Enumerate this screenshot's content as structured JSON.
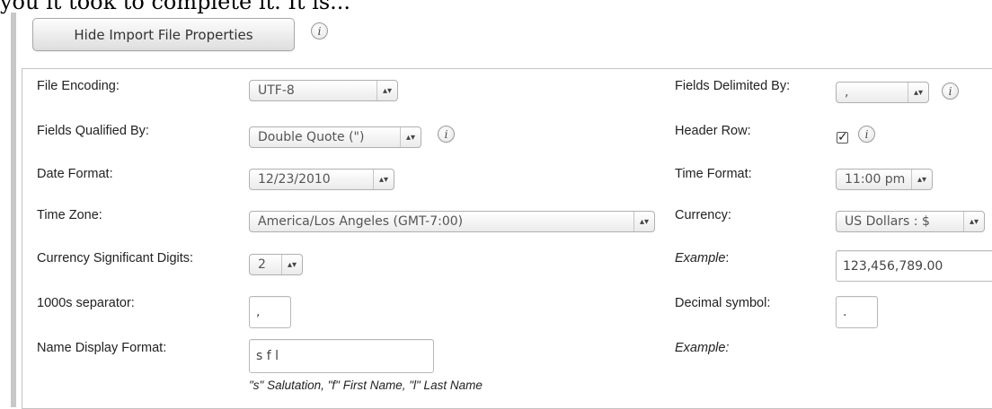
{
  "page": {
    "top_fragment": "you it took to complete it. It is..."
  },
  "toolbar": {
    "hide_button_label": "Hide Import File Properties"
  },
  "info_glyph": "i",
  "arrow_glyph": "▴▾",
  "check_glyph": "✓",
  "fields": {
    "file_encoding": {
      "label": "File Encoding:",
      "value": "UTF-8"
    },
    "fields_delimited_by": {
      "label": "Fields Delimited By:",
      "value": ","
    },
    "fields_qualified_by": {
      "label": "Fields Qualified By:",
      "value": "Double Quote (\")"
    },
    "header_row": {
      "label": "Header Row:",
      "checked": true
    },
    "date_format": {
      "label": "Date Format:",
      "value": "12/23/2010"
    },
    "time_format": {
      "label": "Time Format:",
      "value": "11:00 pm"
    },
    "time_zone": {
      "label": "Time Zone:",
      "value": "America/Los Angeles (GMT-7:00)"
    },
    "currency": {
      "label": "Currency:",
      "value": "US Dollars : $"
    },
    "currency_digits": {
      "label": "Currency Significant Digits:",
      "value": "2"
    },
    "currency_example": {
      "label": "Example",
      "label_suffix": ":",
      "value": "123,456,789.00"
    },
    "thousands_separator": {
      "label": "1000s separator:",
      "value": ","
    },
    "decimal_symbol": {
      "label": "Decimal symbol:",
      "value": "."
    },
    "name_display_format": {
      "label": "Name Display Format:",
      "value": "s f l",
      "hint": "\"s\" Salutation, \"f\" First Name, \"l\" Last Name"
    },
    "name_example": {
      "label": "Example:"
    }
  },
  "icons": [
    "info-icon",
    "select-arrows-icon",
    "checkmark-icon"
  ]
}
